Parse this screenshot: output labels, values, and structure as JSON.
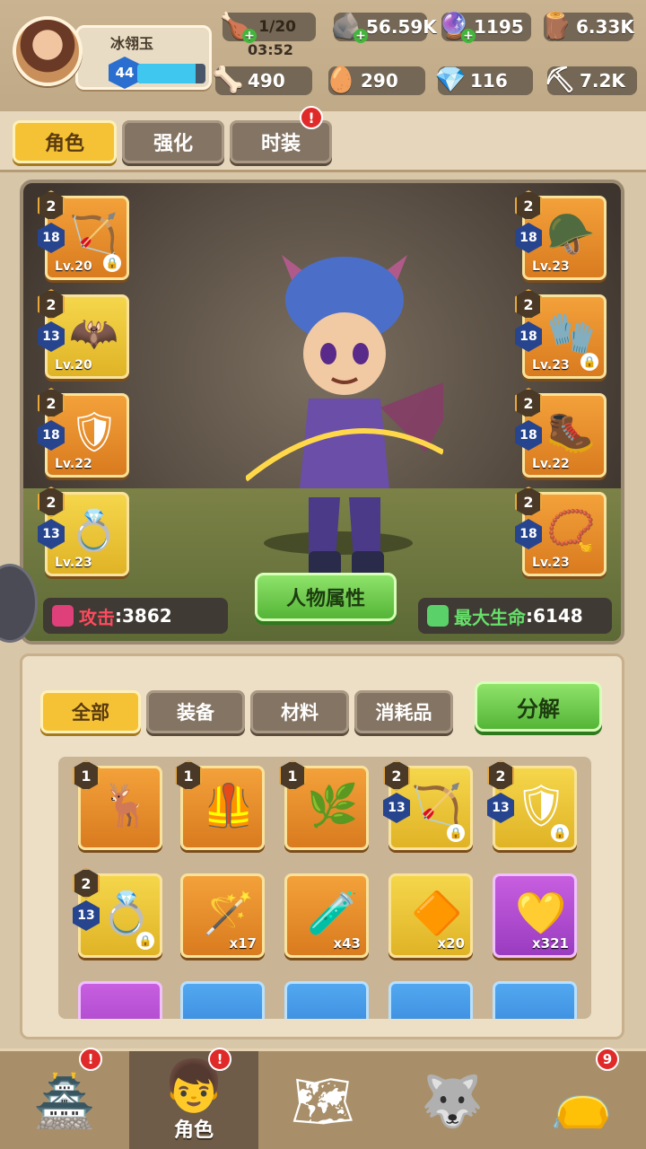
{
  "player": {
    "name": "冰翎玉",
    "level": "44",
    "xp_fraction": 0.85
  },
  "resources": {
    "stamina": {
      "value": "1/20",
      "timer": "03:52"
    },
    "stone": "56.59K",
    "orb": "1195",
    "wood": "6.33K",
    "bone": "490",
    "egg": "290",
    "gem": "116",
    "ore": "7.2K"
  },
  "main_tabs": [
    {
      "label": "角色"
    },
    {
      "label": "强化"
    },
    {
      "label": "时装",
      "alert": "!"
    }
  ],
  "equipment": {
    "left": [
      {
        "rank": "2",
        "power": "18",
        "level": "Lv.20",
        "icon": "bow-icon",
        "glyph": "🏹",
        "locked": true,
        "color": "orange"
      },
      {
        "rank": "2",
        "power": "13",
        "level": "Lv.20",
        "icon": "cape-icon",
        "glyph": "🦇",
        "locked": false,
        "color": "yellow"
      },
      {
        "rank": "2",
        "power": "18",
        "level": "Lv.22",
        "icon": "armor-icon",
        "glyph": "🛡",
        "locked": false,
        "color": "orange"
      },
      {
        "rank": "2",
        "power": "13",
        "level": "Lv.23",
        "icon": "ring-icon",
        "glyph": "💍",
        "locked": false,
        "color": "yellow"
      }
    ],
    "right": [
      {
        "rank": "2",
        "power": "18",
        "level": "Lv.23",
        "icon": "helmet-icon",
        "glyph": "🪖",
        "locked": false,
        "color": "orange"
      },
      {
        "rank": "2",
        "power": "18",
        "level": "Lv.23",
        "icon": "gloves-icon",
        "glyph": "🧤",
        "locked": true,
        "color": "orange"
      },
      {
        "rank": "2",
        "power": "18",
        "level": "Lv.22",
        "icon": "boots-icon",
        "glyph": "🥾",
        "locked": false,
        "color": "orange"
      },
      {
        "rank": "2",
        "power": "18",
        "level": "Lv.23",
        "icon": "necklace-icon",
        "glyph": "📿",
        "locked": false,
        "color": "orange"
      }
    ]
  },
  "stats": {
    "attack_label": "攻击",
    "attack_value": ":3862",
    "hp_label": "最大生命",
    "hp_value": ":6148",
    "attributes_button": "人物属性"
  },
  "inventory": {
    "tabs": [
      "全部",
      "装备",
      "材料",
      "消耗品"
    ],
    "decompose_button": "分解",
    "items": [
      {
        "rank": "1",
        "power": "",
        "count": "",
        "icon": "antler-crown-icon",
        "glyph": "🦌",
        "color": "orange",
        "locked": false
      },
      {
        "rank": "1",
        "power": "",
        "count": "",
        "icon": "blue-vest-icon",
        "glyph": "🦺",
        "color": "orange",
        "locked": false
      },
      {
        "rank": "1",
        "power": "",
        "count": "",
        "icon": "leaf-vest-icon",
        "glyph": "🌿",
        "color": "orange",
        "locked": false
      },
      {
        "rank": "2",
        "power": "13",
        "count": "",
        "icon": "bow-icon",
        "glyph": "🏹",
        "color": "yellow",
        "locked": true
      },
      {
        "rank": "2",
        "power": "13",
        "count": "",
        "icon": "armor-icon",
        "glyph": "🛡",
        "color": "yellow",
        "locked": true
      },
      {
        "rank": "2",
        "power": "13",
        "count": "",
        "icon": "ring-icon",
        "glyph": "💍",
        "color": "yellow",
        "locked": true
      },
      {
        "rank": "",
        "power": "",
        "count": "x17",
        "icon": "magic-staff-icon",
        "glyph": "🪄",
        "color": "orange",
        "locked": false
      },
      {
        "rank": "",
        "power": "",
        "count": "x43",
        "icon": "potion-bottle-icon",
        "glyph": "🧪",
        "color": "orange",
        "locked": false
      },
      {
        "rank": "",
        "power": "",
        "count": "x20",
        "icon": "gold-ore-icon",
        "glyph": "🔶",
        "color": "yellow",
        "locked": false
      },
      {
        "rank": "",
        "power": "",
        "count": "x321",
        "icon": "gold-heart-icon",
        "glyph": "💛",
        "color": "purple",
        "locked": false
      }
    ],
    "partial_row_colors": [
      "purple",
      "blue",
      "blue",
      "blue",
      "blue"
    ]
  },
  "nav": {
    "items": [
      {
        "icon": "castle-icon",
        "glyph": "🏯",
        "label": "",
        "badge": "!"
      },
      {
        "icon": "hero-face-icon",
        "glyph": "👦",
        "label": "角色",
        "badge": "!"
      },
      {
        "icon": "treasure-map-icon",
        "glyph": "🗺",
        "label": "",
        "badge": ""
      },
      {
        "icon": "wolf-pet-icon",
        "glyph": "🐺",
        "label": "",
        "badge": ""
      },
      {
        "icon": "loot-bag-icon",
        "glyph": "👝",
        "label": "",
        "badge": "9"
      }
    ]
  }
}
